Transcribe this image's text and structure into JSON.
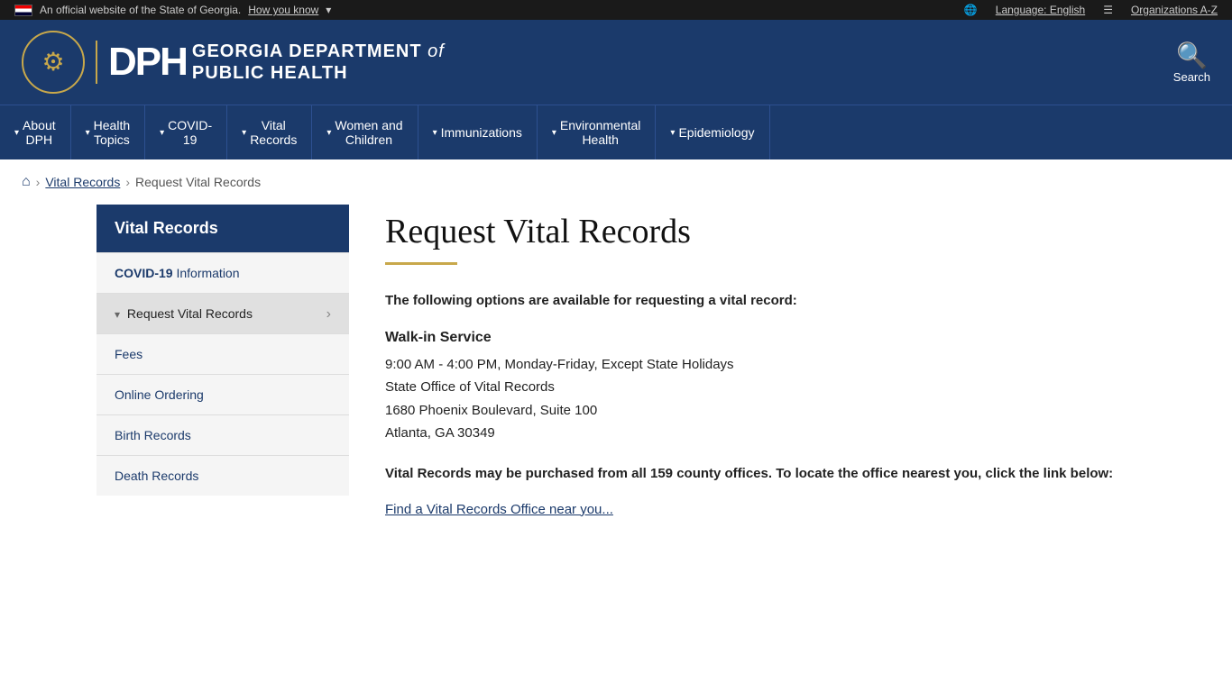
{
  "topbar": {
    "official_text": "An official website of the State of Georgia.",
    "how_you_know": "How you know",
    "language": "Language: English",
    "organizations": "Organizations A-Z"
  },
  "header": {
    "dept_line1": "GEORGIA DEPARTMENT",
    "dept_of": "of",
    "dept_line2": "PUBLIC HEALTH",
    "dph_letters": "DPH",
    "search_label": "Search"
  },
  "nav": {
    "items": [
      {
        "label": "About DPH",
        "has_chevron": true
      },
      {
        "label": "Health Topics",
        "has_chevron": true
      },
      {
        "label": "COVID-19",
        "has_chevron": true
      },
      {
        "label": "Vital Records",
        "has_chevron": true
      },
      {
        "label": "Women and Children",
        "has_chevron": true
      },
      {
        "label": "Immunizations",
        "has_chevron": true
      },
      {
        "label": "Environmental Health",
        "has_chevron": true
      },
      {
        "label": "Epidemiology",
        "has_chevron": true
      }
    ]
  },
  "breadcrumb": {
    "home_title": "Home",
    "vital_records": "Vital Records",
    "current": "Request Vital Records"
  },
  "sidebar": {
    "title": "Vital Records",
    "items": [
      {
        "label": "COVID-19 Information",
        "active": false,
        "highlight": "COVID-19",
        "rest": " Information"
      },
      {
        "label": "Request Vital Records",
        "active": true,
        "has_chevron": true,
        "has_arrow": true
      },
      {
        "label": "Fees",
        "active": false
      },
      {
        "label": "Online Ordering",
        "active": false
      },
      {
        "label": "Birth Records",
        "active": false
      },
      {
        "label": "Death Records",
        "active": false
      }
    ]
  },
  "content": {
    "title": "Request Vital Records",
    "intro_bold": "The following options are available for requesting a vital record:",
    "walk_in_title": "Walk-in Service",
    "walk_in_hours": "9:00 AM - 4:00 PM, Monday-Friday, Except State Holidays",
    "walk_in_office": "State Office of Vital Records",
    "walk_in_address1": "1680 Phoenix Boulevard, Suite 100",
    "walk_in_address2": "Atlanta, GA 30349",
    "county_bold": "Vital Records may be purchased from all 159 county offices. To locate the office nearest you, click the link below:",
    "county_link": "Find a Vital Records Office near you..."
  }
}
